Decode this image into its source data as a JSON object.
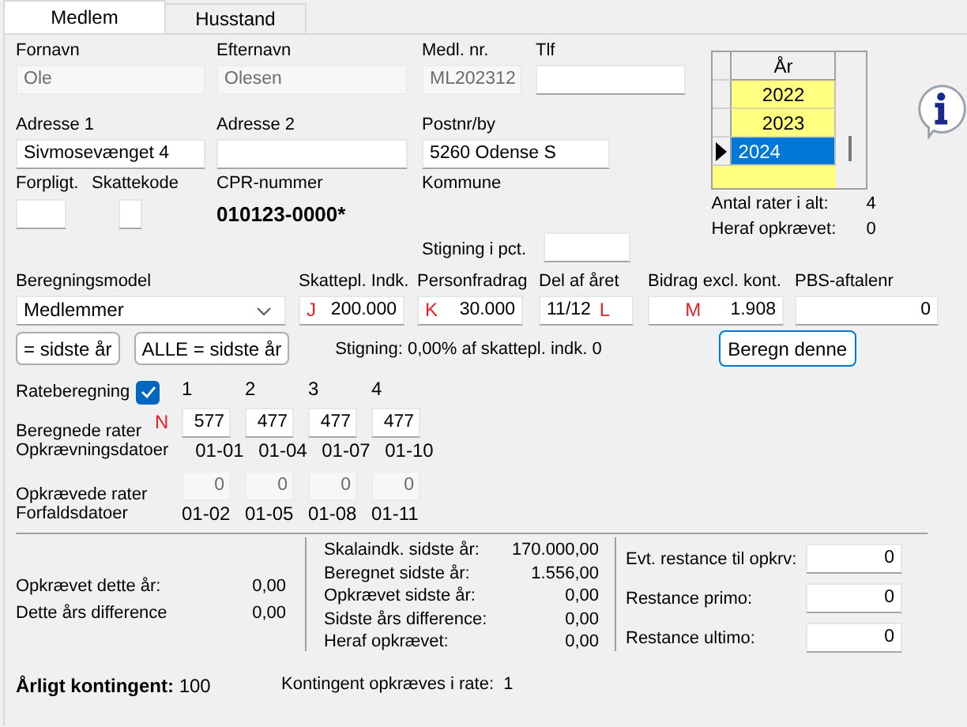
{
  "tabs": [
    {
      "label": "Medlem",
      "selected": true
    },
    {
      "label": "Husstand",
      "selected": false
    }
  ],
  "person_fields": [
    {
      "label": "Fornavn",
      "value": "Ole",
      "disabled": true
    },
    {
      "label": "Efternavn",
      "value": "Olesen",
      "disabled": true
    },
    {
      "label": "Medl. nr.",
      "value": "ML202312",
      "disabled": true
    },
    {
      "label": "Tlf",
      "disabled": false
    }
  ],
  "address_fields": [
    {
      "label": "Adresse 1",
      "value": "Sivmosevænget 4"
    },
    {
      "label": "Adresse 2"
    },
    {
      "label": "Postnr/by",
      "value": "5260 Odense S"
    }
  ],
  "forpligt": {
    "label": "Forpligt."
  },
  "skattekode": {
    "label": "Skattekode"
  },
  "cpr": {
    "label": "CPR-nummer",
    "value": "010123-0000*"
  },
  "kommune": {
    "label": "Kommune"
  },
  "stigning_pct": {
    "label": "Stigning i pct."
  },
  "years": {
    "header": "År",
    "rows": [
      {
        "year": "2022",
        "selected": false
      },
      {
        "year": "2023",
        "selected": false
      },
      {
        "year": "2024",
        "selected": true
      }
    ]
  },
  "rate_summary": [
    {
      "label": "Antal rater i alt:",
      "value": "4"
    },
    {
      "label": "Heraf opkrævet:",
      "value": "0"
    }
  ],
  "calc": {
    "model_label": "Beregningsmodel",
    "model_value": "Medlemmer",
    "amounts": [
      {
        "label": "Skattepl. Indk.",
        "marker": "J",
        "value": "200.000"
      },
      {
        "label": "Personfradrag",
        "marker": "K",
        "value": "30.000"
      },
      {
        "label": "Del af året",
        "marker": "L",
        "value": "11/12"
      },
      {
        "label": "Bidrag excl. kont.",
        "marker": "M",
        "value": "1.908"
      },
      {
        "label": "PBS-aftalenr",
        "value": "0"
      }
    ],
    "copy_buttons": [
      "= sidste år",
      "ALLE = sidste år"
    ],
    "stigning_text": "Stigning: 0,00% af skattepl. indk. 0",
    "calc_button": "Beregn denne"
  },
  "rates": {
    "label": "Rateberegning",
    "checked": true,
    "columns": [
      "1",
      "2",
      "3",
      "4"
    ],
    "rows": [
      {
        "kind": "inputs",
        "label": "Beregnede rater",
        "marker": "N",
        "disabled": false,
        "values": [
          "577",
          "477",
          "477",
          "477"
        ]
      },
      {
        "kind": "dates",
        "label": "Opkrævningsdatoer",
        "values": [
          "01-01",
          "01-04",
          "01-07",
          "01-10"
        ]
      },
      {
        "kind": "inputs",
        "label": "Opkrævede rater",
        "disabled": true,
        "values": [
          "0",
          "0",
          "0",
          "0"
        ]
      },
      {
        "kind": "dates",
        "label": "Forfaldsdatoer",
        "values": [
          "01-02",
          "01-05",
          "01-08",
          "01-11"
        ]
      }
    ]
  },
  "this_year": [
    {
      "label": "Opkrævet dette år:",
      "value": "0,00"
    },
    {
      "label": "Dette års difference",
      "value": "0,00"
    }
  ],
  "last_year": [
    {
      "label": "Skalaindk. sidste år:",
      "value": "170.000,00"
    },
    {
      "label": "Beregnet sidste år:",
      "value": "1.556,00"
    },
    {
      "label": "Opkrævet sidste år:",
      "value": "0,00"
    },
    {
      "label": "Sidste års difference:",
      "value": "0,00"
    },
    {
      "label": "Heraf opkrævet:",
      "value": "0,00"
    }
  ],
  "restance": [
    {
      "label": "Evt. restance til opkrv:",
      "value": "0"
    },
    {
      "label": "Restance primo:",
      "value": "0"
    },
    {
      "label": "Restance ultimo:",
      "value": "0"
    }
  ],
  "footer": {
    "annual": "**Årligt kontingent:** 100",
    "rate_text": "Kontingent opkræves i rate:  1"
  }
}
